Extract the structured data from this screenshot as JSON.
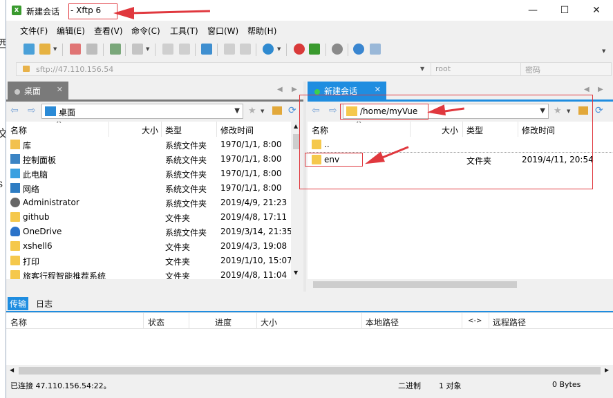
{
  "window": {
    "title": "新建会话",
    "app_name": "- Xftp 6",
    "minimize_glyph": "—",
    "maximize_glyph": "☐",
    "close_glyph": "✕"
  },
  "menu": [
    "文件(F)",
    "编辑(E)",
    "查看(V)",
    "命令(C)",
    "工具(T)",
    "窗口(W)",
    "帮助(H)"
  ],
  "address": {
    "url": "sftp://47.110.156.54",
    "user_placeholder": "root",
    "password_placeholder": "密码"
  },
  "left_pane": {
    "tab_label": "桌面",
    "path": "桌面",
    "columns": [
      "名称",
      "大小",
      "类型",
      "修改时间"
    ],
    "rows": [
      {
        "name": "库",
        "size": "",
        "type": "系统文件夹",
        "modified": "1970/1/1, 8:00",
        "icon": "library-icon"
      },
      {
        "name": "控制面板",
        "size": "",
        "type": "系统文件夹",
        "modified": "1970/1/1, 8:00",
        "icon": "control-panel-icon"
      },
      {
        "name": "此电脑",
        "size": "",
        "type": "系统文件夹",
        "modified": "1970/1/1, 8:00",
        "icon": "computer-icon"
      },
      {
        "name": "网络",
        "size": "",
        "type": "系统文件夹",
        "modified": "1970/1/1, 8:00",
        "icon": "network-icon"
      },
      {
        "name": "Administrator",
        "size": "",
        "type": "系统文件夹",
        "modified": "2019/4/9, 21:23",
        "icon": "user-icon"
      },
      {
        "name": "github",
        "size": "",
        "type": "文件夹",
        "modified": "2019/4/8, 17:11",
        "icon": "folder-icon"
      },
      {
        "name": "OneDrive",
        "size": "",
        "type": "系统文件夹",
        "modified": "2019/3/14, 21:35",
        "icon": "cloud-icon"
      },
      {
        "name": "xshell6",
        "size": "",
        "type": "文件夹",
        "modified": "2019/4/3, 19:08",
        "icon": "folder-icon"
      },
      {
        "name": "打印",
        "size": "",
        "type": "文件夹",
        "modified": "2019/1/10, 15:07",
        "icon": "folder-icon"
      },
      {
        "name": "旅客行程智能推荐系统",
        "size": "",
        "type": "文件夹",
        "modified": "2019/4/8, 11:04",
        "icon": "folder-icon"
      }
    ]
  },
  "right_pane": {
    "tab_label": "新建会话",
    "path": "/home/myVue",
    "columns": [
      "名称",
      "大小",
      "类型",
      "修改时间"
    ],
    "rows": [
      {
        "name": "..",
        "size": "",
        "type": "",
        "modified": "",
        "icon": "folder-icon"
      },
      {
        "name": "env",
        "size": "",
        "type": "文件夹",
        "modified": "2019/4/11, 20:54",
        "icon": "folder-icon"
      }
    ]
  },
  "transfer": {
    "tabs": [
      "传输",
      "日志"
    ],
    "columns": [
      "名称",
      "状态",
      "进度",
      "大小",
      "本地路径",
      "<->",
      "远程路径"
    ]
  },
  "status": {
    "connection": "已连接 47.110.156.54:22。",
    "mode": "二进制",
    "objects": "1 对象",
    "size": "0 Bytes"
  },
  "annotation_color": "#e0383e",
  "accent_color": "#1f8de0"
}
